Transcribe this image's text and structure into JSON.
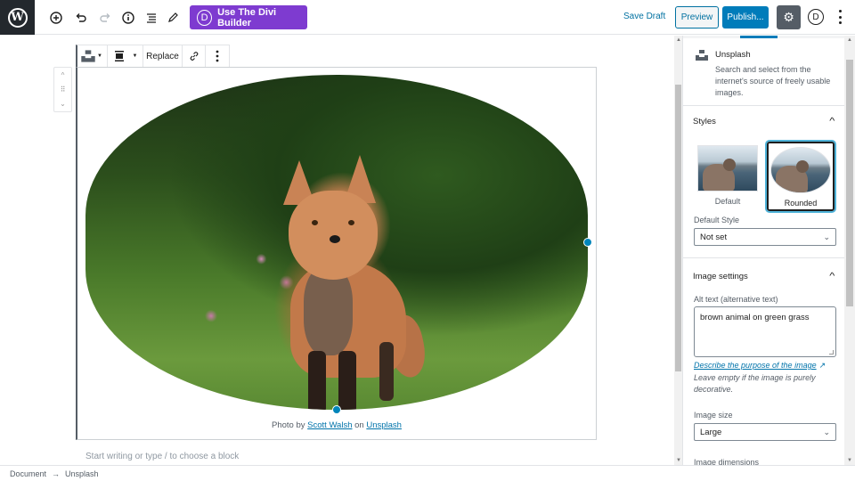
{
  "topbar": {
    "logo": "wordpress-logo",
    "icons": [
      "add-block-icon",
      "undo-icon",
      "redo-icon",
      "info-icon",
      "list-view-icon",
      "edit-icon"
    ],
    "divi_button": {
      "letter": "D",
      "label": "Use The Divi Builder"
    },
    "save_draft": "Save Draft",
    "preview": "Preview",
    "publish": "Publish...",
    "divi_icon_letter": "D",
    "colors": {
      "divi": "#7e3bd0",
      "primary": "#007cba",
      "settings_active": "#555d66"
    }
  },
  "block_toolbar": {
    "block_type_icon": "unsplash-icon",
    "align_icon": "align-center-icon",
    "replace_label": "Replace",
    "link_icon": "link-icon",
    "more_icon": "more-vertical-icon"
  },
  "block_mover": {
    "up": "^",
    "drag": "⠿",
    "down": "⌄"
  },
  "image": {
    "alt": "brown animal on green grass",
    "style": "Rounded",
    "caption": {
      "prefix": "Photo by ",
      "author": "Scott Walsh",
      "middle": " on ",
      "source": "Unsplash"
    }
  },
  "editor": {
    "appender_placeholder": "Start writing or type / to choose a block"
  },
  "breadcrumb": {
    "items": [
      "Document",
      "Unsplash"
    ],
    "separator": "→"
  },
  "sidebar": {
    "block_card": {
      "title": "Unsplash",
      "description": "Search and select from the internet's source of freely usable images."
    },
    "styles": {
      "title": "Styles",
      "options": [
        {
          "label": "Default",
          "selected": false
        },
        {
          "label": "Rounded",
          "selected": true
        }
      ],
      "default_style_label": "Default Style",
      "default_style_value": "Not set"
    },
    "image_settings": {
      "title": "Image settings",
      "alt_label": "Alt text (alternative text)",
      "alt_value": "brown animal on green grass",
      "describe_link": "Describe the purpose of the image",
      "help": "Leave empty if the image is purely decorative.",
      "size_label": "Image size",
      "size_value": "Large",
      "dimensions_label": "Image dimensions"
    }
  }
}
